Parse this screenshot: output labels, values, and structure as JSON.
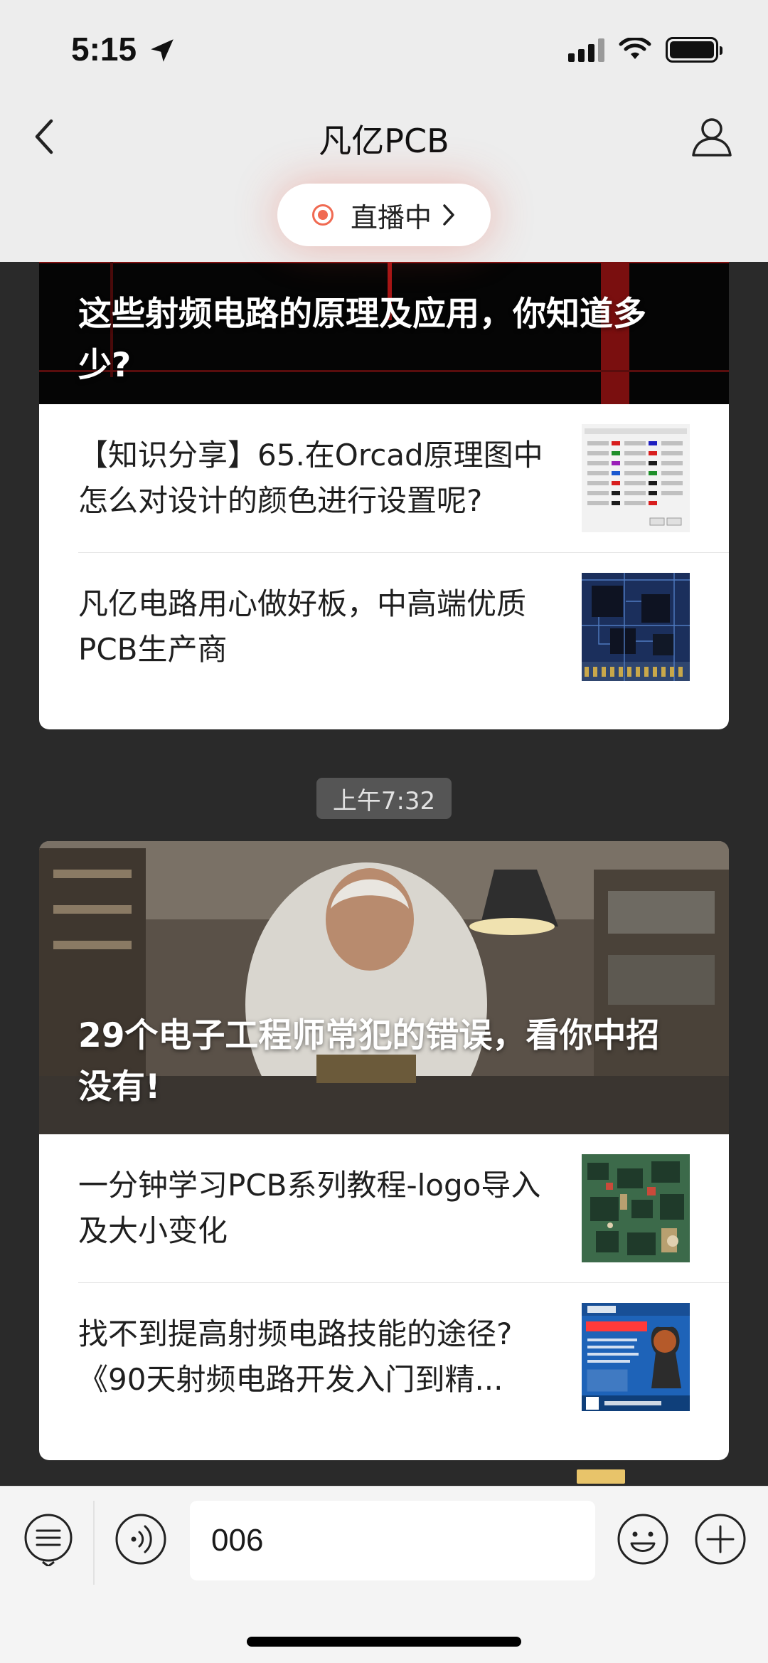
{
  "status_bar": {
    "time": "5:15"
  },
  "header": {
    "title": "凡亿PCB",
    "live_label": "直播中"
  },
  "cards": [
    {
      "hero_title": "这些射频电路的原理及应用，你知道多少?",
      "items": [
        {
          "text": "【知识分享】65.在Orcad原理图中怎么对设计的颜色进行设置呢?",
          "thumb": "color-settings-dialog"
        },
        {
          "text": "凡亿电路用心做好板，中高端优质PCB生产商",
          "thumb": "pcb-board"
        }
      ]
    },
    {
      "timestamp": "上午7:32",
      "hero_title": "29个电子工程师常犯的错误，看你中招没有!",
      "items": [
        {
          "text": "一分钟学习PCB系列教程-logo导入及大小变化",
          "thumb": "pcb-3d-render"
        },
        {
          "text": "找不到提高射频电路技能的途径?《90天射频电路开发入门到精...",
          "thumb": "rf-course-poster"
        }
      ]
    }
  ],
  "input_bar": {
    "value": "006"
  },
  "colors": {
    "live_red": "#f06a52",
    "page_bg": "#2a2a2a",
    "header_bg": "#ededed"
  }
}
